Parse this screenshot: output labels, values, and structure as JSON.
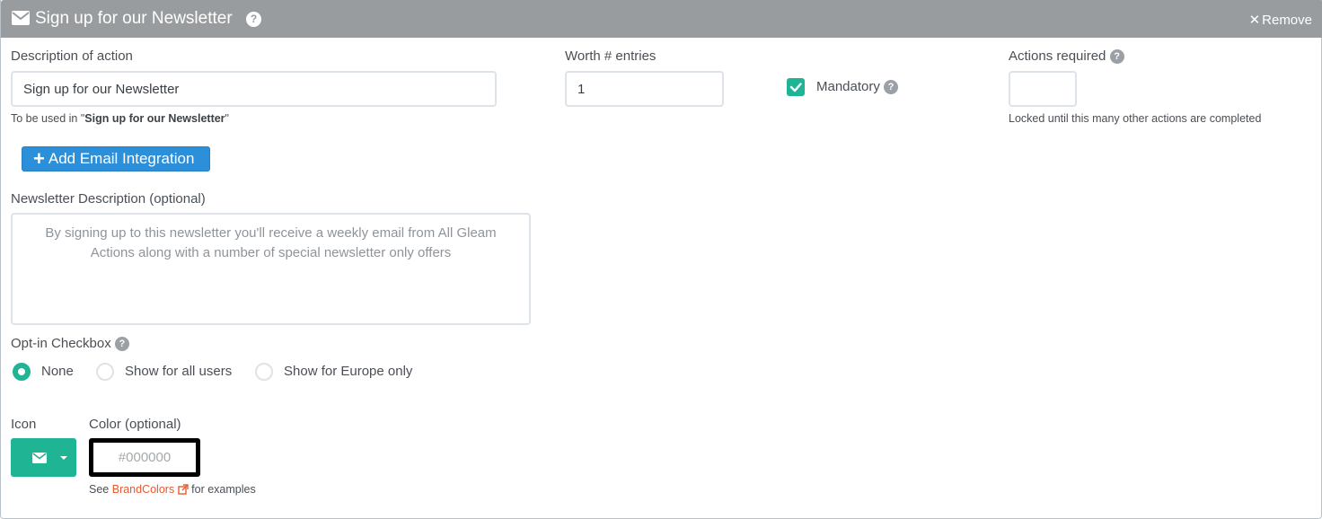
{
  "header": {
    "title": "Sign up for our Newsletter",
    "help": "?",
    "remove_label": "Remove",
    "close_glyph": "✕"
  },
  "description": {
    "label": "Description of action",
    "value": "Sign up for our Newsletter",
    "hint_prefix": "To be used in \"",
    "hint_bold": "Sign up for our Newsletter",
    "hint_suffix": "\""
  },
  "worth": {
    "label": "Worth # entries",
    "value": "1"
  },
  "mandatory": {
    "label": "Mandatory",
    "checked": true,
    "help": "?"
  },
  "actions_required": {
    "label": "Actions required",
    "value": "",
    "hint": "Locked until this many other actions are completed",
    "help": "?"
  },
  "add_integration": {
    "plus": "+",
    "label": "Add Email Integration"
  },
  "newsletter_description": {
    "label": "Newsletter Description (optional)",
    "placeholder": "By signing up to this newsletter you'll receive a weekly email from All Gleam Actions along with a number of special newsletter only offers"
  },
  "optin": {
    "label": "Opt-in Checkbox",
    "help": "?",
    "options": [
      {
        "label": "None",
        "selected": true
      },
      {
        "label": "Show for all users",
        "selected": false
      },
      {
        "label": "Show for Europe only",
        "selected": false
      }
    ]
  },
  "icon": {
    "label": "Icon",
    "selected_icon": "envelope-icon"
  },
  "color": {
    "label": "Color (optional)",
    "placeholder": "#000000",
    "hint_prefix": "See ",
    "hint_link": "BrandColors",
    "hint_suffix": " for examples"
  },
  "colors": {
    "header_bg": "#999c9e",
    "accent_green": "#1fb494",
    "button_blue": "#2c8fd9",
    "link_orange": "#e65a32"
  }
}
